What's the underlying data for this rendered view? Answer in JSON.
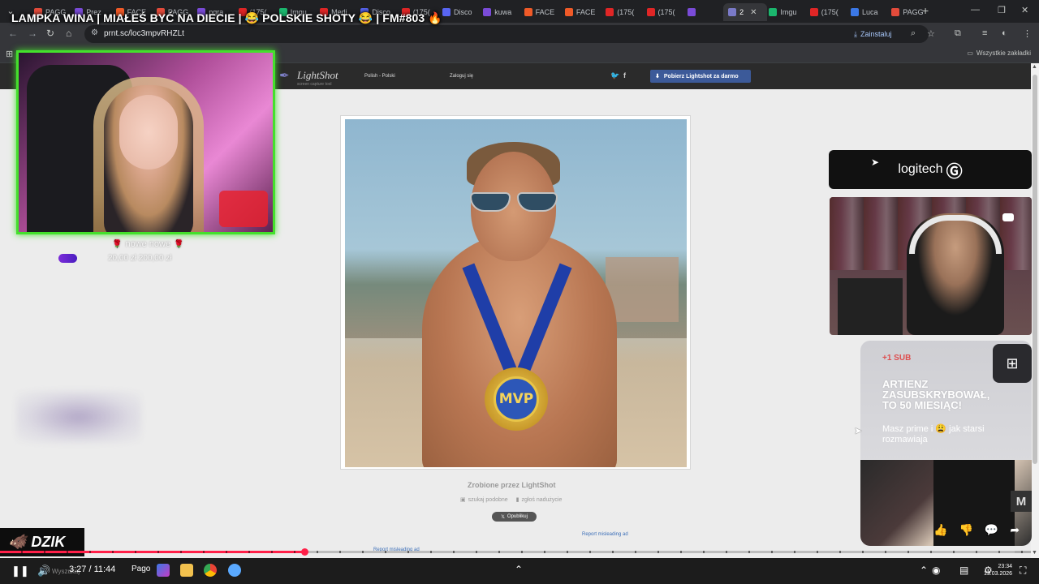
{
  "browser": {
    "tabs": [
      {
        "label": "PAGG",
        "color": "#e34b3b"
      },
      {
        "label": "Prez",
        "color": "#7a4bd8"
      },
      {
        "label": "FACE",
        "color": "#f05a28"
      },
      {
        "label": "PAGG",
        "color": "#e34b3b"
      },
      {
        "label": "pgra",
        "color": "#7a4bd8"
      },
      {
        "label": "(175(",
        "color": "#e02626"
      },
      {
        "label": "Imgu",
        "color": "#1bb76e"
      },
      {
        "label": "Medi",
        "color": "#e02626"
      },
      {
        "label": "Disco",
        "color": "#5865f2"
      },
      {
        "label": "(175(",
        "color": "#e02626"
      },
      {
        "label": "Disco",
        "color": "#5865f2"
      },
      {
        "label": "kuwa",
        "color": "#7a4bd8"
      },
      {
        "label": "FACE",
        "color": "#f05a28"
      },
      {
        "label": "FACE",
        "color": "#f05a28"
      },
      {
        "label": "(175(",
        "color": "#e02626"
      },
      {
        "label": "(175(",
        "color": "#e02626"
      },
      {
        "label": "",
        "color": "#7a4bd8"
      },
      {
        "label": "2",
        "color": "#7a7ac8"
      },
      {
        "label": "Imgu",
        "color": "#1bb76e"
      },
      {
        "label": "(175(",
        "color": "#e02626"
      },
      {
        "label": "Luca",
        "color": "#3b78e7"
      },
      {
        "label": "PAGG",
        "color": "#e34b3b"
      }
    ],
    "active_tab_index": 17,
    "new_tab": "+",
    "url": "prnt.sc/loc3mpvRHZLt",
    "install_label": "Zainstaluj",
    "all_bookmarks_label": "Wszystkie zakładki"
  },
  "lightshot": {
    "brand": "LightShot",
    "tagline": "screen capture tool",
    "language": "Polish - Polski",
    "login": "Zaloguj się",
    "download_button": "Pobierz Lightshot za darmo",
    "made_by": "Zrobione przez LightShot",
    "search_similar": "szukaj podobne",
    "report_abuse": "zgłoś nadużycie",
    "tweet_button": "Opublikuj",
    "report_ad": "Report misleading ad",
    "medal_text": "MVP"
  },
  "stream": {
    "title": "LAMPKA WINA | MIAŁEŚ BYĆ NA DIECIE | 😂 POLSKIE SHOTY 😂 | FM#803 🔥",
    "goal_label": "nowe nowe",
    "goal_amount": "20,00 zł  200,00 zł",
    "goal_progress": 0.1,
    "sponsor": "logitech",
    "sub_badge": "+1 SUB",
    "sub_headline": "ARTIENZ ZASUBSKRYBOWAŁ, TO 50 MIESIĄC!",
    "sub_message": "Masz prime i 😩 jak starsi rozmawiaja",
    "clip_logo": "M",
    "brand": "DZIK"
  },
  "player": {
    "time": "3:27 / 11:44",
    "progress_fraction": 0.295,
    "search_placeholder": "Wyszukaj",
    "report_ad": "Report misleading ad"
  },
  "taskbar": {
    "app_label": "Pago",
    "clock_time": "23:34",
    "clock_date": "13.03.2026"
  },
  "colors": {
    "accent_green": "#44e02c",
    "progress_red": "#ff1f48",
    "lightshot_blue": "#3c5a99",
    "link_blue": "#3c6fb8"
  }
}
